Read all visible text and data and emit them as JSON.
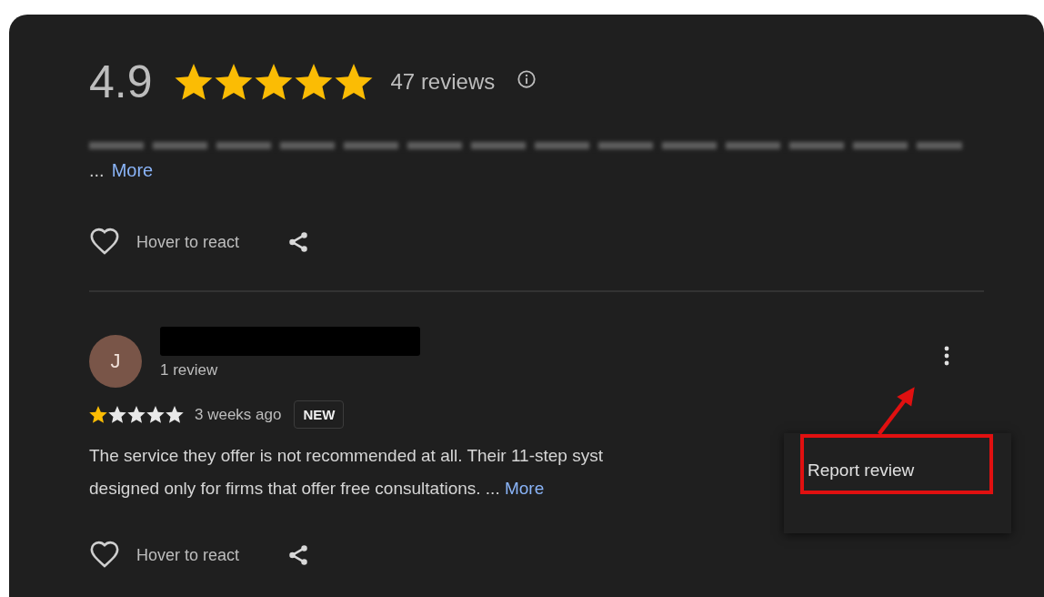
{
  "summary": {
    "rating": "4.9",
    "stars": 5,
    "count": "47 reviews"
  },
  "previous_review": {
    "ellipsis": "...",
    "more": "More",
    "react": "Hover to react"
  },
  "review": {
    "avatar": "J",
    "count": "1 review",
    "stars": 1,
    "time": "3 weeks ago",
    "badge": "NEW",
    "lines": [
      "The service they offer is not recommended at all. Their 11-step syst",
      "designed only for firms that offer free consultations."
    ],
    "ellipsis": "...",
    "more": "More",
    "react": "Hover to react"
  },
  "menu": {
    "items": [
      {
        "label": "Report review"
      }
    ]
  }
}
